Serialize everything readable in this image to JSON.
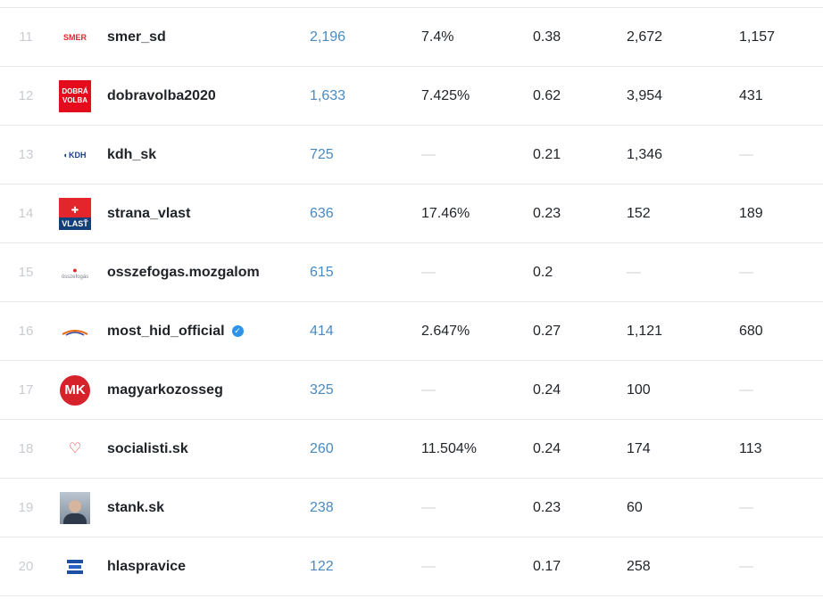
{
  "table": {
    "rows": [
      {
        "rank": "11",
        "logo": "smer-logo-icon",
        "logo_text": "SMER",
        "name": "smer_sd",
        "verified": false,
        "followers": "2,196",
        "engagement": "7.4%",
        "ratio": "0.38",
        "col1": "2,672",
        "col2": "1,157"
      },
      {
        "rank": "12",
        "logo": "dobravolba-logo-icon",
        "logo_text": "DOBRÁ VOLBA",
        "name": "dobravolba2020",
        "verified": false,
        "followers": "1,633",
        "engagement": "7.425%",
        "ratio": "0.62",
        "col1": "3,954",
        "col2": "431"
      },
      {
        "rank": "13",
        "logo": "kdh-logo-icon",
        "logo_text": "KDH",
        "name": "kdh_sk",
        "verified": false,
        "followers": "725",
        "engagement": "—",
        "ratio": "0.21",
        "col1": "1,346",
        "col2": "—"
      },
      {
        "rank": "14",
        "logo": "vlast-logo-icon",
        "logo_text": "VLASŤ",
        "name": "strana_vlast",
        "verified": false,
        "followers": "636",
        "engagement": "17.46%",
        "ratio": "0.23",
        "col1": "152",
        "col2": "189"
      },
      {
        "rank": "15",
        "logo": "osszefogas-logo-icon",
        "logo_text": "összefogás",
        "name": "osszefogas.mozgalom",
        "verified": false,
        "followers": "615",
        "engagement": "—",
        "ratio": "0.2",
        "col1": "—",
        "col2": "—"
      },
      {
        "rank": "16",
        "logo": "most-hid-logo-icon",
        "logo_text": "",
        "name": "most_hid_official",
        "verified": true,
        "followers": "414",
        "engagement": "2.647%",
        "ratio": "0.27",
        "col1": "1,121",
        "col2": "680"
      },
      {
        "rank": "17",
        "logo": "mk-logo-icon",
        "logo_text": "MK",
        "name": "magyarkozosseg",
        "verified": false,
        "followers": "325",
        "engagement": "—",
        "ratio": "0.24",
        "col1": "100",
        "col2": "—"
      },
      {
        "rank": "18",
        "logo": "socialisti-logo-icon",
        "logo_text": "",
        "name": "socialisti.sk",
        "verified": false,
        "followers": "260",
        "engagement": "11.504%",
        "ratio": "0.24",
        "col1": "174",
        "col2": "113"
      },
      {
        "rank": "19",
        "logo": "avatar",
        "logo_text": "",
        "name": "stank.sk",
        "verified": false,
        "followers": "238",
        "engagement": "—",
        "ratio": "0.23",
        "col1": "60",
        "col2": "—"
      },
      {
        "rank": "20",
        "logo": "hlas-logo-icon",
        "logo_text": "",
        "name": "hlaspravice",
        "verified": false,
        "followers": "122",
        "engagement": "—",
        "ratio": "0.17",
        "col1": "258",
        "col2": "—"
      }
    ]
  },
  "colors": {
    "link_blue": "#4a8ac2",
    "rank_gray": "#c9ccd1",
    "divider": "#e6e8eb",
    "verified_blue": "#2f93e8"
  }
}
